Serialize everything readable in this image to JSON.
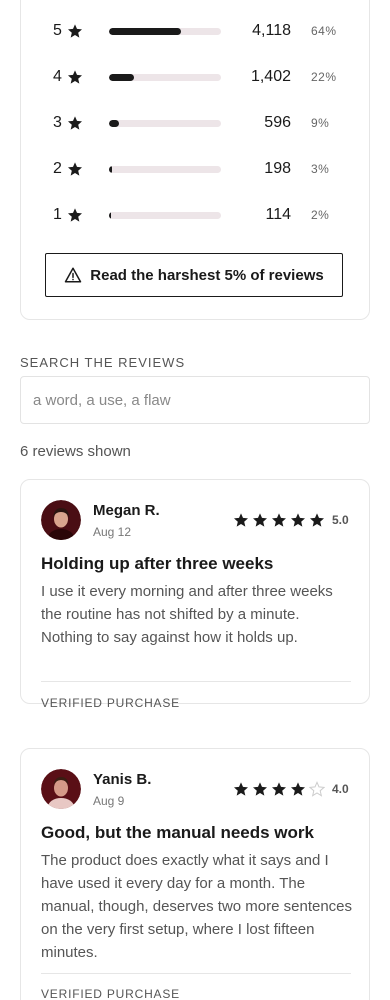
{
  "ratings": [
    {
      "stars": "5",
      "count": "4,118",
      "pct": "64%",
      "fraction": 0.64
    },
    {
      "stars": "4",
      "count": "1,402",
      "pct": "22%",
      "fraction": 0.22
    },
    {
      "stars": "3",
      "count": "596",
      "pct": "9%",
      "fraction": 0.09
    },
    {
      "stars": "2",
      "count": "198",
      "pct": "3%",
      "fraction": 0.03
    },
    {
      "stars": "1",
      "count": "114",
      "pct": "2%",
      "fraction": 0.02
    }
  ],
  "harsh_button": {
    "label": "Read the harshest 5% of reviews",
    "icon": "warning-icon"
  },
  "search": {
    "label": "SEARCH THE REVIEWS",
    "placeholder": "a word, a use, a flaw",
    "value": ""
  },
  "reviews_count": "6 reviews shown",
  "reviews": [
    {
      "name": "Megan R.",
      "date": "Aug 12",
      "rating": 5,
      "score": "5.0",
      "title": "Holding up after three weeks",
      "body": "I use it every morning and after three weeks the routine has not shifted by a minute. Nothing to say against how it holds up.",
      "badge": "VERIFIED PURCHASE"
    },
    {
      "name": "Yanis B.",
      "date": "Aug 9",
      "rating": 4,
      "score": "4.0",
      "title": "Good, but the manual needs work",
      "body": "The product does exactly what it says and I have used it every day for a month. The manual, though, deserves two more sentences on the very first setup, where I lost fifteen minutes.",
      "badge": "VERIFIED PURCHASE"
    }
  ],
  "colors": {
    "bar_fill": "#1a1a1a",
    "bar_track": "#ede5e8",
    "star_filled": "#1a1a1a",
    "star_empty": "#cccccc"
  }
}
